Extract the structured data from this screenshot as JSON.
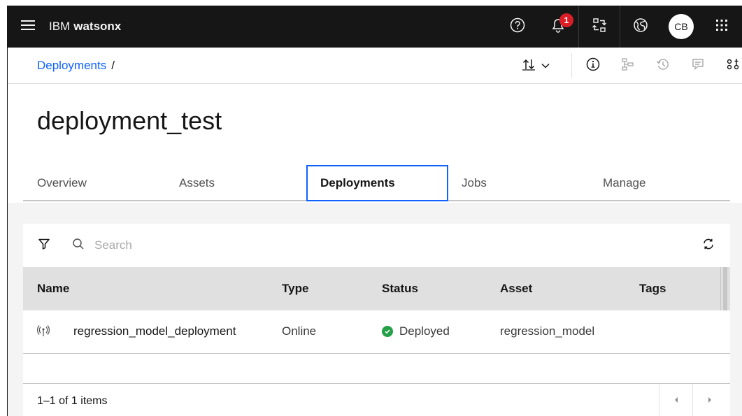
{
  "header": {
    "brand_prefix": "IBM",
    "brand_name": "watsonx",
    "notification_count": "1",
    "avatar_initials": "CB"
  },
  "breadcrumb": {
    "items": [
      "Deployments"
    ],
    "separator": "/"
  },
  "page": {
    "title": "deployment_test"
  },
  "tabs": [
    {
      "label": "Overview",
      "active": false
    },
    {
      "label": "Assets",
      "active": false
    },
    {
      "label": "Deployments",
      "active": true
    },
    {
      "label": "Jobs",
      "active": false
    },
    {
      "label": "Manage",
      "active": false
    }
  ],
  "search": {
    "placeholder": "Search"
  },
  "table": {
    "columns": [
      "Name",
      "Type",
      "Status",
      "Asset",
      "Tags"
    ],
    "rows": [
      {
        "name": "regression_model_deployment",
        "type": "Online",
        "status": "Deployed",
        "asset": "regression_model",
        "tags": ""
      }
    ]
  },
  "pagination": {
    "summary": "1–1 of 1 items"
  },
  "colors": {
    "topbar": "#161616",
    "link": "#0f62fe",
    "active_tab_border": "#0f62fe",
    "badge": "#da1e28",
    "status_deployed": "#24a148",
    "table_header": "#e0e0e0",
    "content_bg": "#f4f4f4"
  },
  "icons": {
    "menu": "hamburger-icon",
    "help": "help-icon",
    "notification": "bell-icon",
    "switcher": "transfer-icon",
    "globe": "globe-icon",
    "apps": "app-grid-icon",
    "sort": "sort-icon",
    "info": "information-icon",
    "flow": "flow-icon",
    "history": "history-icon",
    "comment": "comment-icon",
    "settings": "settings-adjust-icon",
    "filter": "filter-icon",
    "search": "search-icon",
    "refresh": "refresh-icon",
    "deployment": "online-deployment-icon",
    "status_ok": "checkmark-filled-icon"
  }
}
